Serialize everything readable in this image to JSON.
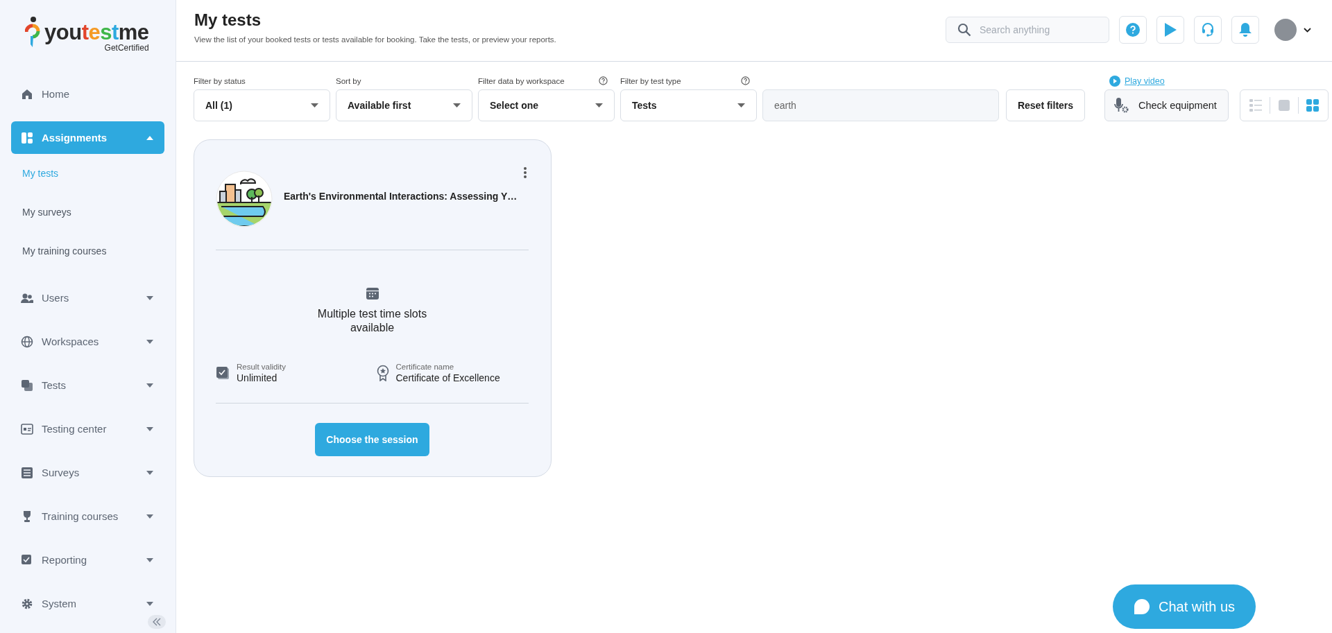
{
  "logo": {
    "parts": [
      {
        "text": "you",
        "color": "#2b2b2b"
      },
      {
        "text": "t",
        "color": "#e2452b"
      },
      {
        "text": "e",
        "color": "#f59a23"
      },
      {
        "text": "s",
        "color": "#3fb649"
      },
      {
        "text": "t",
        "color": "#2ea9df"
      },
      {
        "text": "me",
        "color": "#2b2b2b"
      }
    ],
    "tagline": "GetCertified"
  },
  "sidebar": {
    "items": [
      {
        "kind": "link",
        "label": "Home",
        "selected": false
      },
      {
        "kind": "group",
        "label": "Assignments",
        "selected": true,
        "expanded": true,
        "children": [
          {
            "label": "My tests",
            "selected": true
          },
          {
            "label": "My surveys",
            "selected": false
          },
          {
            "label": "My training courses",
            "selected": false
          }
        ]
      },
      {
        "kind": "group",
        "label": "Users",
        "selected": false,
        "expanded": false
      },
      {
        "kind": "group",
        "label": "Workspaces",
        "selected": false,
        "expanded": false
      },
      {
        "kind": "group",
        "label": "Tests",
        "selected": false,
        "expanded": false
      },
      {
        "kind": "group",
        "label": "Testing center",
        "selected": false,
        "expanded": false
      },
      {
        "kind": "group",
        "label": "Surveys",
        "selected": false,
        "expanded": false
      },
      {
        "kind": "group",
        "label": "Training courses",
        "selected": false,
        "expanded": false
      },
      {
        "kind": "group",
        "label": "Reporting",
        "selected": false,
        "expanded": false
      },
      {
        "kind": "group",
        "label": "System",
        "selected": false,
        "expanded": false
      }
    ]
  },
  "header": {
    "title": "My tests",
    "subtitle": "View the list of your booked tests or tests available for booking. Take the tests, or preview your reports.",
    "search": {
      "placeholder": "Search anything"
    }
  },
  "filters": [
    {
      "label": "Filter by status",
      "value": "All (1)",
      "help": false
    },
    {
      "label": "Sort by",
      "value": "Available first",
      "help": false
    },
    {
      "label": "Filter data by workspace",
      "value": "Select one",
      "help": true
    },
    {
      "label": "Filter by test type",
      "value": "Tests",
      "help": true
    }
  ],
  "filter_search": {
    "value": "earth"
  },
  "reset_button": "Reset filters",
  "play_video": "Play video",
  "check_equipment": "Check equipment",
  "view_modes": [
    {
      "selected": false
    },
    {
      "selected": false
    },
    {
      "selected": true
    }
  ],
  "card": {
    "title": "Earth's Environmental Interactions: Assessing Y…",
    "slots": "Multiple test time slots available",
    "info": [
      {
        "label": "Result validity",
        "value": "Unlimited"
      },
      {
        "label": "Certificate name",
        "value": "Certificate of Excellence"
      }
    ],
    "button": "Choose the session"
  },
  "chat_button": "Chat with us"
}
